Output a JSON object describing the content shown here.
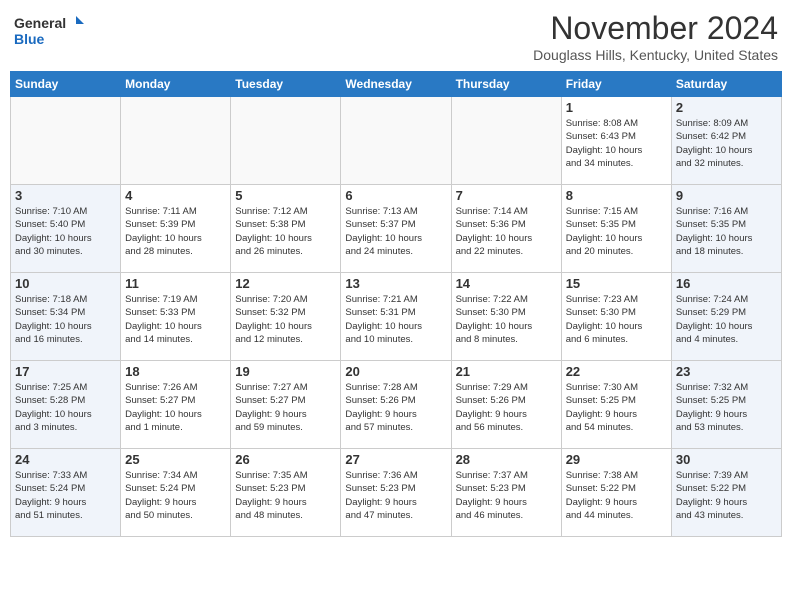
{
  "header": {
    "logo_line1": "General",
    "logo_line2": "Blue",
    "month": "November 2024",
    "location": "Douglass Hills, Kentucky, United States"
  },
  "days_of_week": [
    "Sunday",
    "Monday",
    "Tuesday",
    "Wednesday",
    "Thursday",
    "Friday",
    "Saturday"
  ],
  "weeks": [
    [
      {
        "day": "",
        "info": "",
        "type": "empty"
      },
      {
        "day": "",
        "info": "",
        "type": "empty"
      },
      {
        "day": "",
        "info": "",
        "type": "empty"
      },
      {
        "day": "",
        "info": "",
        "type": "empty"
      },
      {
        "day": "",
        "info": "",
        "type": "empty"
      },
      {
        "day": "1",
        "info": "Sunrise: 8:08 AM\nSunset: 6:43 PM\nDaylight: 10 hours\nand 34 minutes.",
        "type": "weekend"
      },
      {
        "day": "2",
        "info": "Sunrise: 8:09 AM\nSunset: 6:42 PM\nDaylight: 10 hours\nand 32 minutes.",
        "type": "weekend"
      }
    ],
    [
      {
        "day": "3",
        "info": "Sunrise: 7:10 AM\nSunset: 5:40 PM\nDaylight: 10 hours\nand 30 minutes.",
        "type": "weekend"
      },
      {
        "day": "4",
        "info": "Sunrise: 7:11 AM\nSunset: 5:39 PM\nDaylight: 10 hours\nand 28 minutes.",
        "type": "weekday"
      },
      {
        "day": "5",
        "info": "Sunrise: 7:12 AM\nSunset: 5:38 PM\nDaylight: 10 hours\nand 26 minutes.",
        "type": "weekday"
      },
      {
        "day": "6",
        "info": "Sunrise: 7:13 AM\nSunset: 5:37 PM\nDaylight: 10 hours\nand 24 minutes.",
        "type": "weekday"
      },
      {
        "day": "7",
        "info": "Sunrise: 7:14 AM\nSunset: 5:36 PM\nDaylight: 10 hours\nand 22 minutes.",
        "type": "weekday"
      },
      {
        "day": "8",
        "info": "Sunrise: 7:15 AM\nSunset: 5:35 PM\nDaylight: 10 hours\nand 20 minutes.",
        "type": "weekend"
      },
      {
        "day": "9",
        "info": "Sunrise: 7:16 AM\nSunset: 5:35 PM\nDaylight: 10 hours\nand 18 minutes.",
        "type": "weekend"
      }
    ],
    [
      {
        "day": "10",
        "info": "Sunrise: 7:18 AM\nSunset: 5:34 PM\nDaylight: 10 hours\nand 16 minutes.",
        "type": "weekend"
      },
      {
        "day": "11",
        "info": "Sunrise: 7:19 AM\nSunset: 5:33 PM\nDaylight: 10 hours\nand 14 minutes.",
        "type": "weekday"
      },
      {
        "day": "12",
        "info": "Sunrise: 7:20 AM\nSunset: 5:32 PM\nDaylight: 10 hours\nand 12 minutes.",
        "type": "weekday"
      },
      {
        "day": "13",
        "info": "Sunrise: 7:21 AM\nSunset: 5:31 PM\nDaylight: 10 hours\nand 10 minutes.",
        "type": "weekday"
      },
      {
        "day": "14",
        "info": "Sunrise: 7:22 AM\nSunset: 5:30 PM\nDaylight: 10 hours\nand 8 minutes.",
        "type": "weekday"
      },
      {
        "day": "15",
        "info": "Sunrise: 7:23 AM\nSunset: 5:30 PM\nDaylight: 10 hours\nand 6 minutes.",
        "type": "weekend"
      },
      {
        "day": "16",
        "info": "Sunrise: 7:24 AM\nSunset: 5:29 PM\nDaylight: 10 hours\nand 4 minutes.",
        "type": "weekend"
      }
    ],
    [
      {
        "day": "17",
        "info": "Sunrise: 7:25 AM\nSunset: 5:28 PM\nDaylight: 10 hours\nand 3 minutes.",
        "type": "weekend"
      },
      {
        "day": "18",
        "info": "Sunrise: 7:26 AM\nSunset: 5:27 PM\nDaylight: 10 hours\nand 1 minute.",
        "type": "weekday"
      },
      {
        "day": "19",
        "info": "Sunrise: 7:27 AM\nSunset: 5:27 PM\nDaylight: 9 hours\nand 59 minutes.",
        "type": "weekday"
      },
      {
        "day": "20",
        "info": "Sunrise: 7:28 AM\nSunset: 5:26 PM\nDaylight: 9 hours\nand 57 minutes.",
        "type": "weekday"
      },
      {
        "day": "21",
        "info": "Sunrise: 7:29 AM\nSunset: 5:26 PM\nDaylight: 9 hours\nand 56 minutes.",
        "type": "weekday"
      },
      {
        "day": "22",
        "info": "Sunrise: 7:30 AM\nSunset: 5:25 PM\nDaylight: 9 hours\nand 54 minutes.",
        "type": "weekend"
      },
      {
        "day": "23",
        "info": "Sunrise: 7:32 AM\nSunset: 5:25 PM\nDaylight: 9 hours\nand 53 minutes.",
        "type": "weekend"
      }
    ],
    [
      {
        "day": "24",
        "info": "Sunrise: 7:33 AM\nSunset: 5:24 PM\nDaylight: 9 hours\nand 51 minutes.",
        "type": "weekend"
      },
      {
        "day": "25",
        "info": "Sunrise: 7:34 AM\nSunset: 5:24 PM\nDaylight: 9 hours\nand 50 minutes.",
        "type": "weekday"
      },
      {
        "day": "26",
        "info": "Sunrise: 7:35 AM\nSunset: 5:23 PM\nDaylight: 9 hours\nand 48 minutes.",
        "type": "weekday"
      },
      {
        "day": "27",
        "info": "Sunrise: 7:36 AM\nSunset: 5:23 PM\nDaylight: 9 hours\nand 47 minutes.",
        "type": "weekday"
      },
      {
        "day": "28",
        "info": "Sunrise: 7:37 AM\nSunset: 5:23 PM\nDaylight: 9 hours\nand 46 minutes.",
        "type": "weekday"
      },
      {
        "day": "29",
        "info": "Sunrise: 7:38 AM\nSunset: 5:22 PM\nDaylight: 9 hours\nand 44 minutes.",
        "type": "weekend"
      },
      {
        "day": "30",
        "info": "Sunrise: 7:39 AM\nSunset: 5:22 PM\nDaylight: 9 hours\nand 43 minutes.",
        "type": "weekend"
      }
    ]
  ]
}
